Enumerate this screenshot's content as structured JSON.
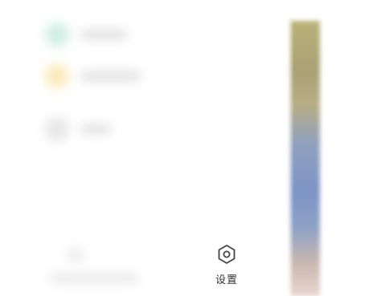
{
  "footer": {
    "settings_label": "设置",
    "settings_icon": "settings-hexagon-icon"
  },
  "colors": {
    "panel_bg": "#ffffff",
    "label_text": "#333333",
    "icon_stroke": "#444444"
  }
}
